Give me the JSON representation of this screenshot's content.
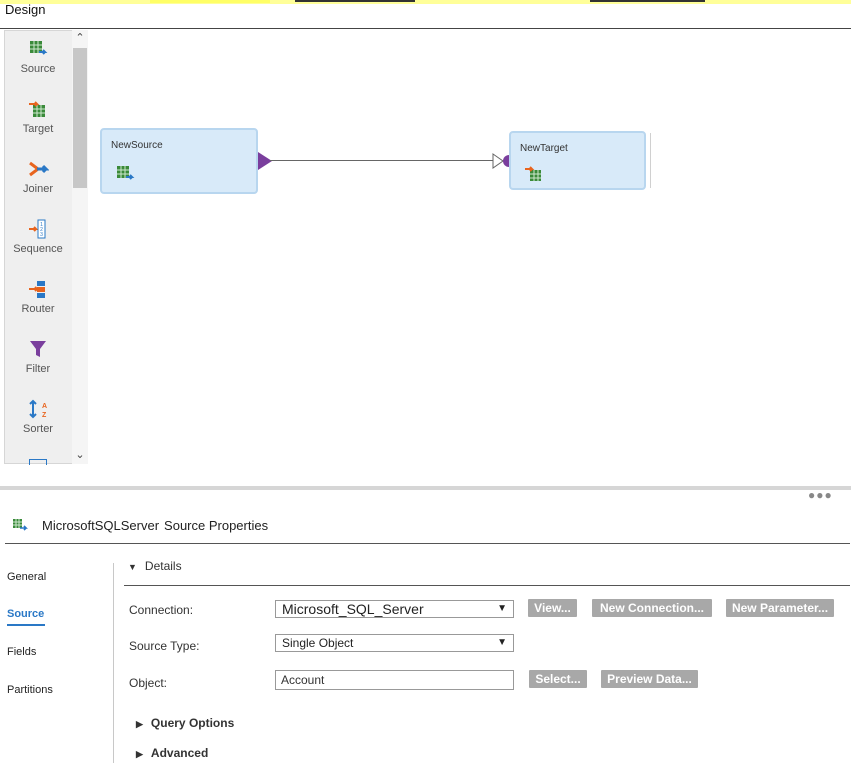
{
  "design_header": "Design",
  "palette": {
    "items": [
      {
        "label": "Source",
        "icon": "source-icon"
      },
      {
        "label": "Target",
        "icon": "target-icon"
      },
      {
        "label": "Joiner",
        "icon": "joiner-icon"
      },
      {
        "label": "Sequence",
        "icon": "sequence-icon"
      },
      {
        "label": "Router",
        "icon": "router-icon"
      },
      {
        "label": "Filter",
        "icon": "filter-icon"
      },
      {
        "label": "Sorter",
        "icon": "sorter-icon"
      }
    ]
  },
  "canvas": {
    "source_node": "NewSource",
    "target_node": "NewTarget"
  },
  "properties": {
    "title_main": "MicrosoftSQLServer",
    "title_suffix": "Source Properties",
    "nav": [
      "General",
      "Source",
      "Fields",
      "Partitions"
    ],
    "active_nav": "Source",
    "details_label": "Details",
    "connection_label": "Connection:",
    "connection_value": "Microsoft_SQL_Server",
    "source_type_label": "Source Type:",
    "source_type_value": "Single Object",
    "object_label": "Object:",
    "object_value": "Account",
    "buttons": {
      "view": "View...",
      "new_connection": "New Connection...",
      "new_parameter": "New Parameter...",
      "select": "Select...",
      "preview_data": "Preview Data..."
    },
    "query_options": "Query Options",
    "advanced": "Advanced"
  },
  "colors": {
    "accent": "#2a78c6",
    "node_fill": "#d8eaf9",
    "link_marker": "#7a3e9d",
    "button_gray": "#a8a8a8"
  }
}
